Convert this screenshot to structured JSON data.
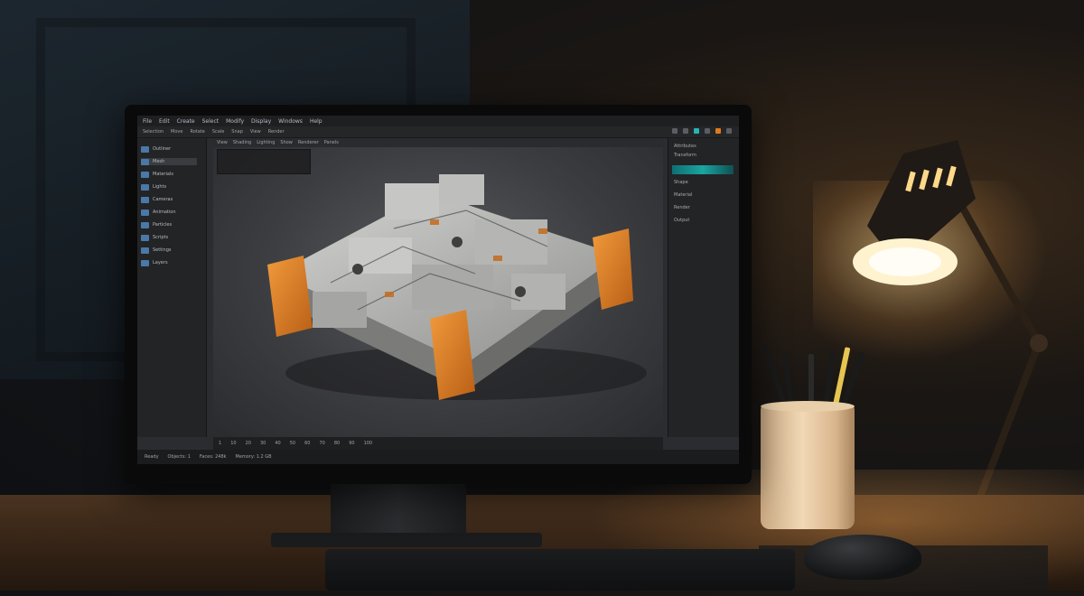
{
  "app": {
    "menubar": [
      "File",
      "Edit",
      "Create",
      "Select",
      "Modify",
      "Display",
      "Windows",
      "Help"
    ],
    "toolbar": [
      "Selection",
      "Move",
      "Rotate",
      "Scale",
      "Snap",
      "View",
      "Render"
    ],
    "viewport_header": [
      "View",
      "Shading",
      "Lighting",
      "Show",
      "Renderer",
      "Panels"
    ],
    "left_panel_items": [
      "Outliner",
      "Mesh",
      "Materials",
      "Lights",
      "Cameras",
      "Animation",
      "Particles",
      "Scripts",
      "Settings",
      "Layers"
    ],
    "right_panel_rows": [
      "Attributes",
      "Transform",
      "Shape",
      "Material",
      "Render",
      "Output"
    ],
    "timeline": [
      "1",
      "10",
      "20",
      "30",
      "40",
      "50",
      "60",
      "70",
      "80",
      "90",
      "100"
    ],
    "status": [
      "Ready",
      "Objects: 1",
      "Faces: 248k",
      "Memory: 1.2 GB"
    ]
  },
  "colors": {
    "accent_orange": "#e07a1f",
    "accent_teal": "#1aa6a0",
    "model_gray": "#b8b9b6"
  }
}
